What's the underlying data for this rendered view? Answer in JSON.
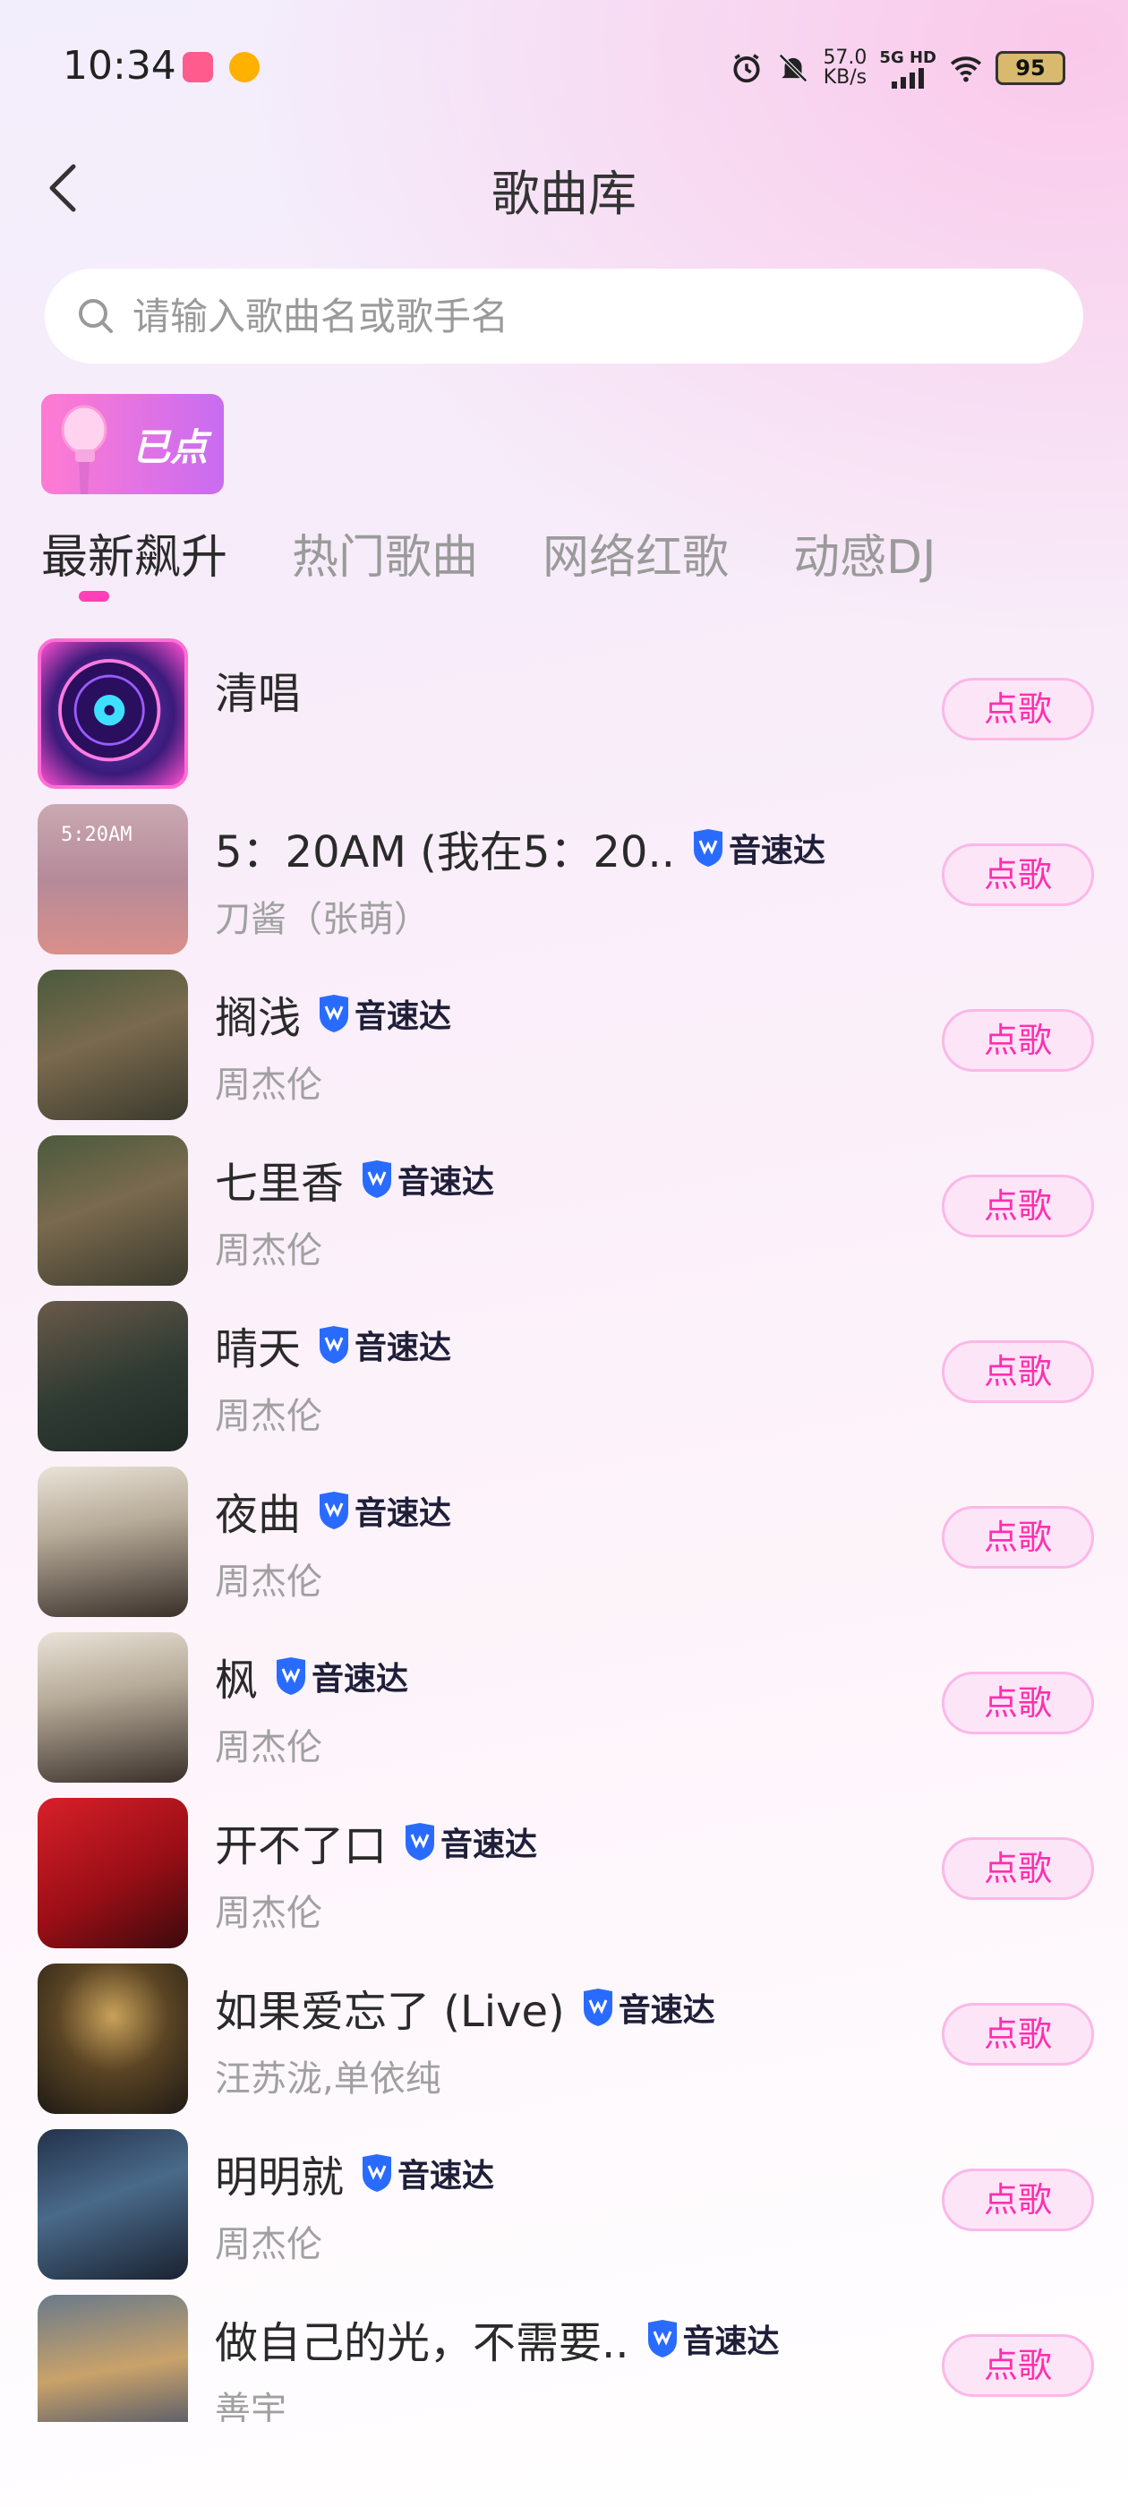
{
  "status_bar": {
    "time": "10:34",
    "net_speed_value": "57.0",
    "net_speed_unit": "KB/s",
    "network": "5G HD",
    "battery": "95"
  },
  "header": {
    "title": "歌曲库",
    "back_icon": "chevron-left-icon"
  },
  "search": {
    "placeholder": "请输入歌曲名或歌手名"
  },
  "ordered_badge": {
    "label": "已点"
  },
  "tabs": [
    {
      "label": "最新飙升",
      "active": true
    },
    {
      "label": "热门歌曲",
      "active": false
    },
    {
      "label": "网络红歌",
      "active": false
    },
    {
      "label": "动感DJ",
      "active": false
    }
  ],
  "colors": {
    "accent": "#ff2fae",
    "button_bg": "#fde5f8",
    "tab_indicator": "#ff3fb5",
    "badge_blue": "#2a6bff"
  },
  "songs": [
    {
      "title": "清唱",
      "artist": "",
      "badge": "",
      "button": "点歌"
    },
    {
      "title": "5：20AM (我在5：20..",
      "artist": "刀酱（张萌）",
      "badge": "音速达",
      "button": "点歌"
    },
    {
      "title": "搁浅",
      "artist": "周杰伦",
      "badge": "音速达",
      "button": "点歌"
    },
    {
      "title": "七里香",
      "artist": "周杰伦",
      "badge": "音速达",
      "button": "点歌"
    },
    {
      "title": "晴天",
      "artist": "周杰伦",
      "badge": "音速达",
      "button": "点歌"
    },
    {
      "title": "夜曲",
      "artist": "周杰伦",
      "badge": "音速达",
      "button": "点歌"
    },
    {
      "title": "枫",
      "artist": "周杰伦",
      "badge": "音速达",
      "button": "点歌"
    },
    {
      "title": "开不了口",
      "artist": "周杰伦",
      "badge": "音速达",
      "button": "点歌"
    },
    {
      "title": "如果爱忘了 (Live)",
      "artist": "汪苏泷,单依纯",
      "badge": "音速达",
      "button": "点歌"
    },
    {
      "title": "明明就",
      "artist": "周杰伦",
      "badge": "音速达",
      "button": "点歌"
    },
    {
      "title": "做自己的光，不需要..",
      "artist": "善宇",
      "badge": "音速达",
      "button": "点歌"
    }
  ]
}
